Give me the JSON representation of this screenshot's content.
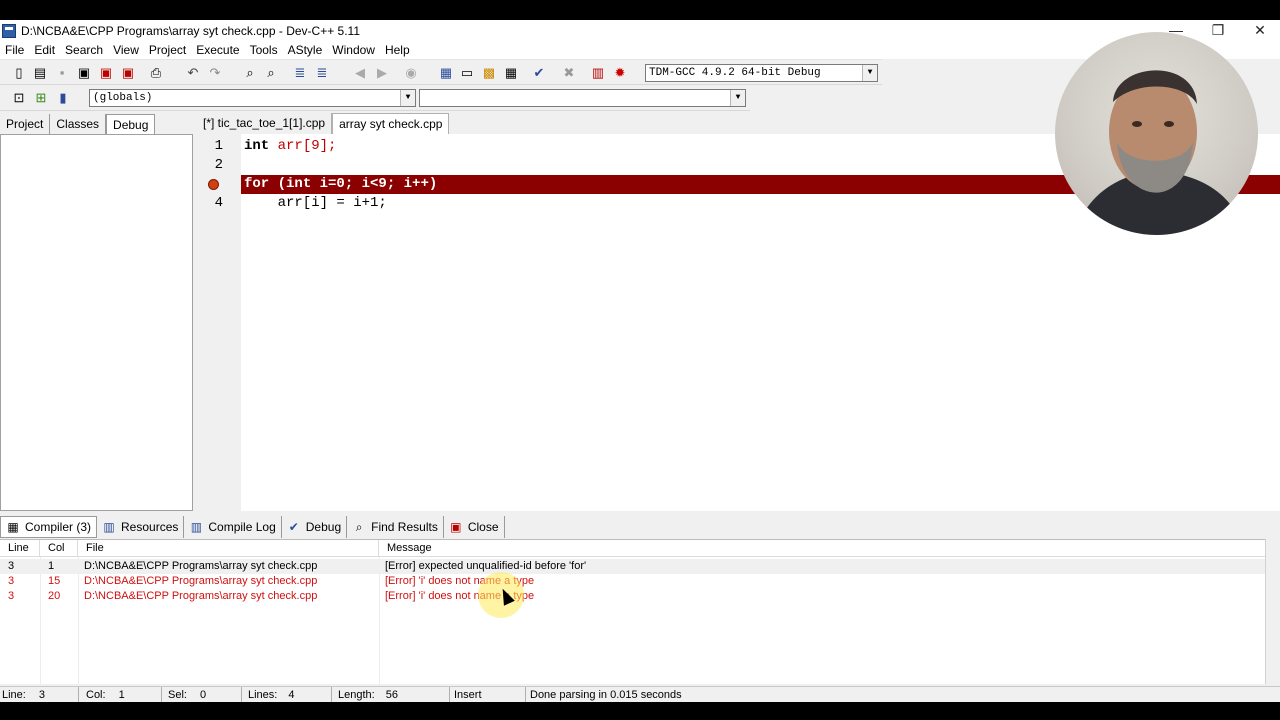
{
  "window": {
    "title": "D:\\NCBA&E\\CPP Programs\\array syt check.cpp - Dev-C++ 5.11",
    "minimize": "—",
    "restore": "❐",
    "close": "✕"
  },
  "menu": [
    "File",
    "Edit",
    "Search",
    "View",
    "Project",
    "Execute",
    "Tools",
    "AStyle",
    "Window",
    "Help"
  ],
  "toolbar": {
    "compiler_select": "TDM-GCC 4.9.2 64-bit Debug",
    "scope_select": "(globals)",
    "symbol_select": ""
  },
  "left_tabs": [
    {
      "label": "Project",
      "active": false
    },
    {
      "label": "Classes",
      "active": false
    },
    {
      "label": "Debug",
      "active": true
    }
  ],
  "editor_tabs": [
    {
      "label": "[*] tic_tac_toe_1[1].cpp",
      "active": false
    },
    {
      "label": "array syt check.cpp",
      "active": true
    }
  ],
  "code_lines": [
    {
      "num": "1",
      "kw": "int",
      "rest": " arr[9];"
    },
    {
      "num": "2",
      "kw": "",
      "rest": ""
    },
    {
      "num": "",
      "kw": "for",
      "rest": " (int i=0; i<9; i++)",
      "highlighted": true,
      "breakpoint": true
    },
    {
      "num": "4",
      "kw": "",
      "rest": "    arr[i] = i+1;"
    }
  ],
  "bottom_tabs": [
    {
      "label": "Compiler (3)",
      "icon": "grid-icon",
      "active": true
    },
    {
      "label": "Resources",
      "icon": "resources-icon",
      "active": false
    },
    {
      "label": "Compile Log",
      "icon": "log-icon",
      "active": false
    },
    {
      "label": "Debug",
      "icon": "check-icon",
      "active": false
    },
    {
      "label": "Find Results",
      "icon": "find-icon",
      "active": false
    },
    {
      "label": "Close",
      "icon": "close-icon",
      "active": false
    }
  ],
  "messages": {
    "columns": [
      "Line",
      "Col",
      "File",
      "Message"
    ],
    "rows": [
      {
        "line": "3",
        "col": "1",
        "file": "D:\\NCBA&E\\CPP Programs\\array syt check.cpp",
        "message": "[Error] expected unqualified-id before 'for'",
        "error": false,
        "selected": true
      },
      {
        "line": "3",
        "col": "15",
        "file": "D:\\NCBA&E\\CPP Programs\\array syt check.cpp",
        "message": "[Error] 'i' does not name a type",
        "error": true,
        "selected": false
      },
      {
        "line": "3",
        "col": "20",
        "file": "D:\\NCBA&E\\CPP Programs\\array syt check.cpp",
        "message": "[Error] 'i' does not name a type",
        "error": true,
        "selected": false
      }
    ]
  },
  "status": {
    "line_label": "Line:",
    "line_value": "3",
    "col_label": "Col:",
    "col_value": "1",
    "sel_label": "Sel:",
    "sel_value": "0",
    "lines_label": "Lines:",
    "lines_value": "4",
    "length_label": "Length:",
    "length_value": "56",
    "mode": "Insert",
    "message": "Done parsing in 0.015 seconds"
  }
}
